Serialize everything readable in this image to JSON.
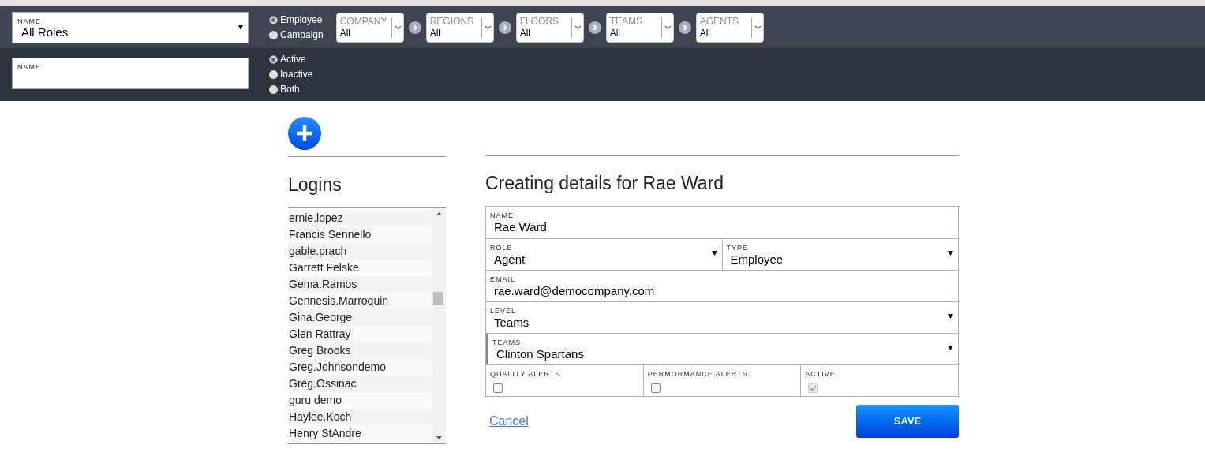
{
  "filter_bar": {
    "role_select": {
      "label": "NAME",
      "value": "All Roles",
      "arrow": "▾"
    },
    "scope_options": [
      {
        "label": "Employee",
        "selected": true
      },
      {
        "label": "Campaign",
        "selected": false
      }
    ],
    "hierarchy": [
      {
        "label": "COMPANY",
        "value": "All"
      },
      {
        "label": "REGIONS",
        "value": "All"
      },
      {
        "label": "FLOORS",
        "value": "All"
      },
      {
        "label": "TEAMS",
        "value": "All"
      },
      {
        "label": "AGENTS",
        "value": "All"
      }
    ],
    "name_field": {
      "label": "NAME"
    },
    "status_options": [
      {
        "label": "Active",
        "selected": true
      },
      {
        "label": "Inactive",
        "selected": false
      },
      {
        "label": "Both",
        "selected": false
      }
    ]
  },
  "logins": {
    "title": "Logins",
    "items": [
      "ernie.lopez",
      "Francis Sennello",
      "gable.prach",
      "Garrett Felske",
      "Gema.Ramos",
      "Gennesis.Marroquin",
      "Gina.George",
      "Glen Rattray",
      "Greg Brooks",
      "Greg.Johnsondemo",
      "Greg.Ossinac",
      "guru demo",
      "Haylee.Koch",
      "Henry StAndre"
    ]
  },
  "details": {
    "title": "Creating details for Rae Ward",
    "rows": [
      [
        {
          "kind": "text",
          "label": "NAME",
          "value": "Rae Ward",
          "highlighted": false
        }
      ],
      [
        {
          "kind": "select",
          "label": "ROLE",
          "value": "Agent",
          "highlighted": false
        },
        {
          "kind": "select",
          "label": "TYPE",
          "value": "Employee",
          "highlighted": false
        }
      ],
      [
        {
          "kind": "text",
          "label": "EMAIL",
          "value": "rae.ward@democompany.com",
          "highlighted": false
        }
      ],
      [
        {
          "kind": "select",
          "label": "LEVEL",
          "value": "Teams",
          "highlighted": false
        }
      ],
      [
        {
          "kind": "select",
          "label": "TEAMS",
          "value": "Clinton Spartans",
          "highlighted": true
        }
      ],
      [
        {
          "kind": "checkbox",
          "label": "QUALITY ALERTS",
          "checked": false,
          "disabled": false
        },
        {
          "kind": "checkbox",
          "label": "PERMORMANCE ALERTS",
          "checked": false,
          "disabled": false
        },
        {
          "kind": "checkbox",
          "label": "ACTIVE",
          "checked": true,
          "disabled": true
        }
      ]
    ],
    "cancel": "Cancel",
    "save": "SAVE"
  }
}
